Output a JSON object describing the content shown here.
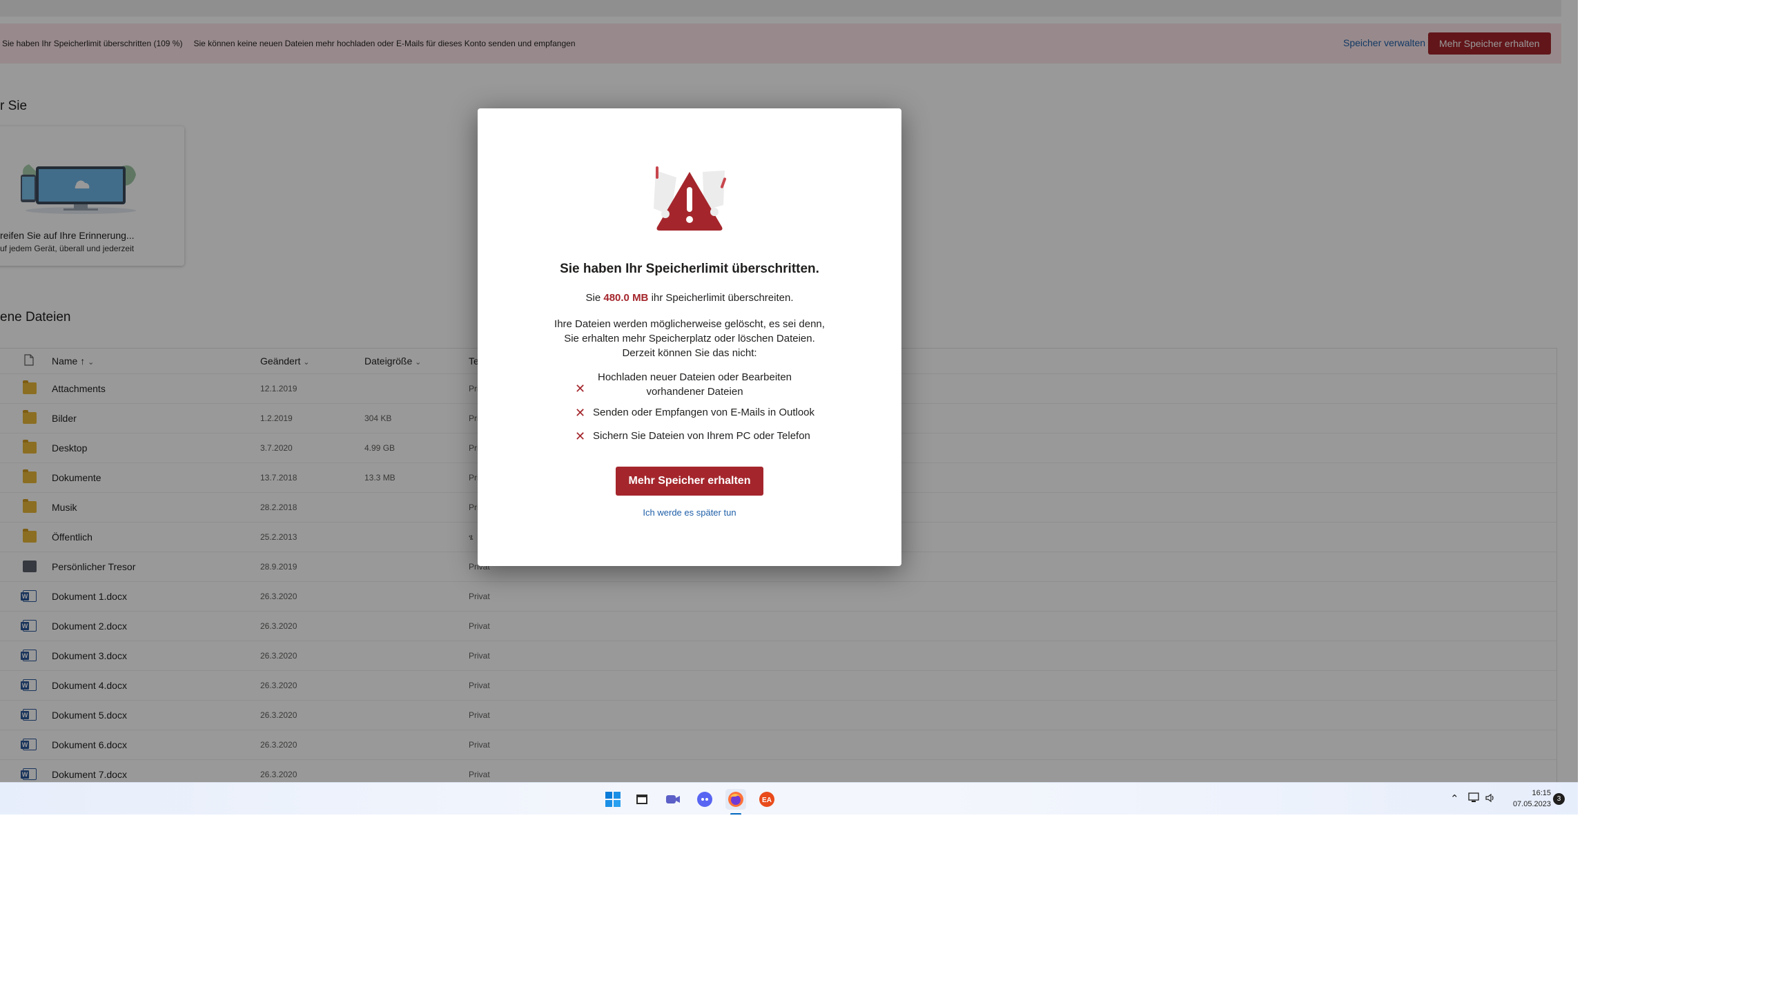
{
  "banner": {
    "title": "Sie haben Ihr Speicherlimit überschritten (109 %)",
    "description": "Sie können keine neuen Dateien mehr hochladen oder E-Mails für dieses Konto senden und empfangen",
    "manage_link": "Speicher verwalten",
    "more_button": "Mehr Speicher erhalten"
  },
  "for_you": {
    "title": "r Sie",
    "card_title": "reifen Sie auf Ihre Erinnerung...",
    "card_subtitle": "uf jedem Gerät, überall und jederzeit"
  },
  "files": {
    "title": "ene Dateien",
    "columns": {
      "name": "Name ↑",
      "modified": "Geändert",
      "size": "Dateigröße",
      "sharing": "Te"
    },
    "rows": [
      {
        "type": "folder",
        "name": "Attachments",
        "modified": "12.1.2019",
        "size": "",
        "sharing": "Pri"
      },
      {
        "type": "folder",
        "name": "Bilder",
        "modified": "1.2.2019",
        "size": "304 KB",
        "sharing": "Pri"
      },
      {
        "type": "folder",
        "name": "Desktop",
        "modified": "3.7.2020",
        "size": "4.99 GB",
        "sharing": "Pri"
      },
      {
        "type": "folder",
        "name": "Dokumente",
        "modified": "13.7.2018",
        "size": "13.3 MB",
        "sharing": "Pri"
      },
      {
        "type": "folder",
        "name": "Musik",
        "modified": "28.2.2018",
        "size": "",
        "sharing": "Pri"
      },
      {
        "type": "folder-shared",
        "name": "Öffentlich",
        "modified": "25.2.2013",
        "size": "",
        "sharing": "ፄ"
      },
      {
        "type": "vault",
        "name": "Persönlicher Tresor",
        "modified": "28.9.2019",
        "size": "",
        "sharing": "Privat"
      },
      {
        "type": "word",
        "name": "Dokument 1.docx",
        "modified": "26.3.2020",
        "size": "",
        "sharing": "Privat"
      },
      {
        "type": "word",
        "name": "Dokument 2.docx",
        "modified": "26.3.2020",
        "size": "",
        "sharing": "Privat"
      },
      {
        "type": "word",
        "name": "Dokument 3.docx",
        "modified": "26.3.2020",
        "size": "",
        "sharing": "Privat"
      },
      {
        "type": "word",
        "name": "Dokument 4.docx",
        "modified": "26.3.2020",
        "size": "",
        "sharing": "Privat"
      },
      {
        "type": "word",
        "name": "Dokument 5.docx",
        "modified": "26.3.2020",
        "size": "",
        "sharing": "Privat"
      },
      {
        "type": "word",
        "name": "Dokument 6.docx",
        "modified": "26.3.2020",
        "size": "",
        "sharing": "Privat"
      },
      {
        "type": "word",
        "name": "Dokument 7.docx",
        "modified": "26.3.2020",
        "size": "",
        "sharing": "Privat"
      }
    ]
  },
  "dialog": {
    "title": "Sie haben Ihr Speicherlimit überschritten.",
    "amount_prefix": "Sie",
    "amount_value": "480.0 MB",
    "amount_suffix": "ihr Speicherlimit überschreiten.",
    "description": "Ihre Dateien werden möglicherweise gelöscht, es sei denn, Sie erhalten mehr Speicherplatz oder löschen Dateien. Derzeit können Sie das nicht:",
    "items": [
      "Hochladen neuer Dateien oder Bearbeiten vorhandener Dateien",
      "Senden oder Empfangen von E-Mails in Outlook",
      "Sichern Sie Dateien von Ihrem PC oder Telefon"
    ],
    "primary_button": "Mehr Speicher erhalten",
    "later_link": "Ich werde es später tun"
  },
  "taskbar": {
    "apps": [
      "windows-start",
      "file-explorer",
      "teams-chat",
      "discord",
      "firefox",
      "ea-app"
    ],
    "time": "16:15",
    "date": "07.05.2023",
    "notification_count": "3"
  },
  "colors": {
    "accent_red": "#a4262c",
    "link_blue": "#1f5fa8",
    "banner_bg": "#fde7e9"
  }
}
